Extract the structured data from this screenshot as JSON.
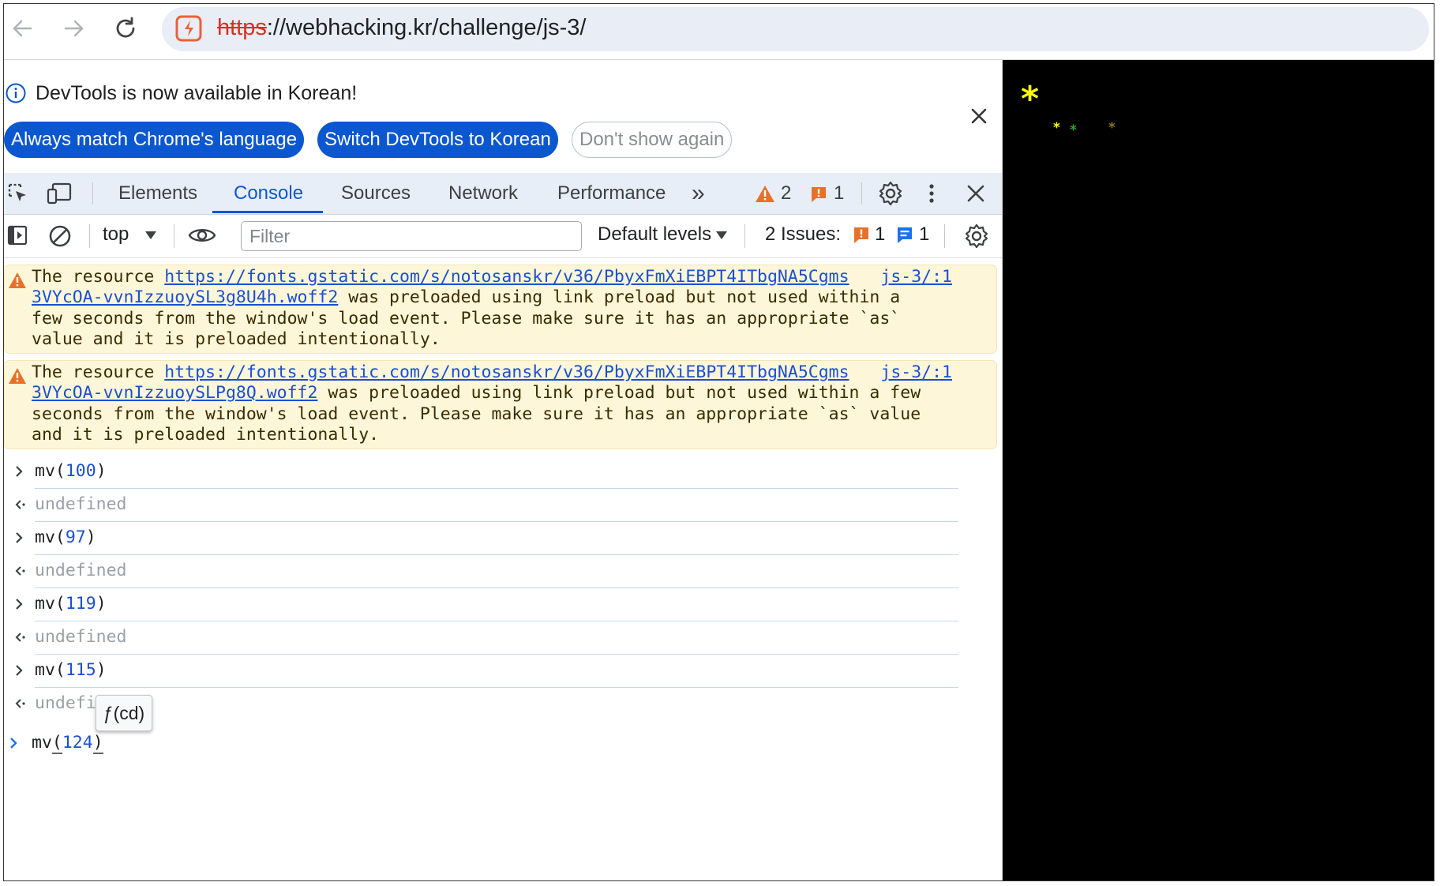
{
  "browser": {
    "url_scheme": "https",
    "url_rest": "://webhacking.kr/challenge/js-3/"
  },
  "infobar": {
    "message": "DevTools is now available in Korean!",
    "btn_match": "Always match Chrome's language",
    "btn_switch": "Switch DevTools to Korean",
    "btn_dont_show": "Don't show again"
  },
  "tabs": {
    "elements": "Elements",
    "console": "Console",
    "sources": "Sources",
    "network": "Network",
    "performance": "Performance",
    "more": "»",
    "warning_count": "2",
    "error_count": "1"
  },
  "filterbar": {
    "context": "top",
    "filter_placeholder": "Filter",
    "levels": "Default levels",
    "issues_label": "2 Issues:",
    "issues_error_count": "1",
    "issues_info_count": "1"
  },
  "console": {
    "warnings": [
      {
        "prefix": "The resource ",
        "link": "https://fonts.gstatic.com/s/notosanskr/v36/PbyxFmXiEBPT4ITbgNA5Cgms\n3VYcOA-vvnIzzuoySL3g8U4h.woff2",
        "suffix": " was preloaded using link preload but not used within a\nfew seconds from the window's load event. Please make sure it has an appropriate `as`\nvalue and it is preloaded intentionally.",
        "source": "js-3/:1"
      },
      {
        "prefix": "The resource ",
        "link": "https://fonts.gstatic.com/s/notosanskr/v36/PbyxFmXiEBPT4ITbgNA5Cgms\n3VYcOA-vvnIzzuoySLPg8Q.woff2",
        "suffix": " was preloaded using link preload but not used within a few\nseconds from the window's load event. Please make sure it has an appropriate `as` value\nand it is preloaded intentionally.",
        "source": "js-3/:1"
      }
    ],
    "entries": [
      {
        "type": "input",
        "fn": "mv(",
        "arg": "100",
        "close": ")"
      },
      {
        "type": "result",
        "text": "undefined"
      },
      {
        "type": "input",
        "fn": "mv(",
        "arg": "97",
        "close": ")"
      },
      {
        "type": "result",
        "text": "undefined"
      },
      {
        "type": "input",
        "fn": "mv(",
        "arg": "119",
        "close": ")"
      },
      {
        "type": "result",
        "text": "undefined"
      },
      {
        "type": "input",
        "fn": "mv(",
        "arg": "115",
        "close": ")"
      },
      {
        "type": "result",
        "text": "undefi"
      }
    ],
    "tooltip": "ƒ(cd)",
    "prompt": {
      "fn": "mv",
      "open": "(",
      "arg": "124",
      "close": ")"
    }
  },
  "page": {
    "star_main": "*",
    "star_small_1": "*",
    "star_small_2": "*",
    "star_small_3": "*",
    "colors": {
      "yellow": "#ffff00",
      "green": "#33aa22",
      "olive": "#887722"
    }
  }
}
